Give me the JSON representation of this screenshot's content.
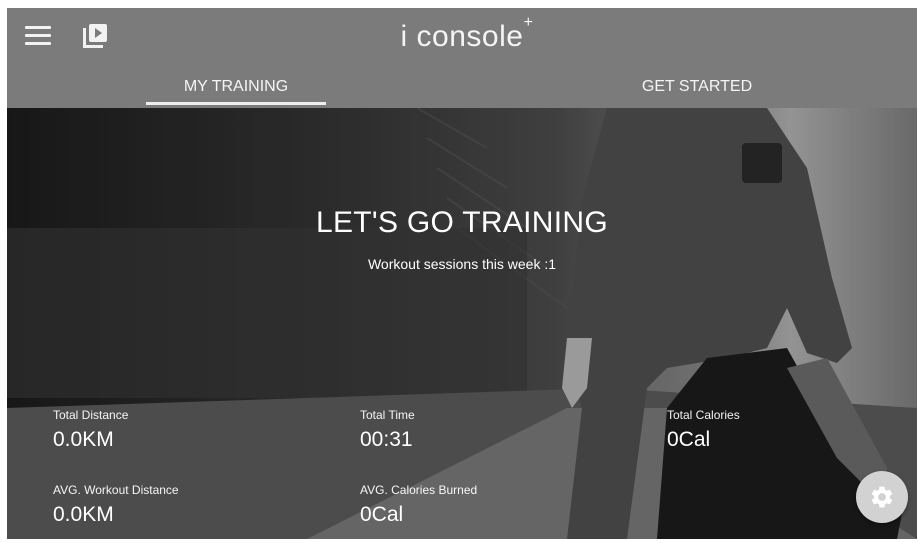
{
  "app": {
    "logo_text": "i console",
    "logo_mark": "+"
  },
  "header": {
    "menu_icon": "hamburger-menu-icon",
    "video_icon": "video-library-icon",
    "tabs": [
      {
        "label": "MY TRAINING",
        "active": true
      },
      {
        "label": "GET STARTED",
        "active": false
      }
    ]
  },
  "hero": {
    "title": "LET'S GO TRAINING",
    "subtitle": "Workout sessions this week :1"
  },
  "stats": {
    "total_distance": {
      "label": "Total Distance",
      "value": "0.0KM"
    },
    "total_time": {
      "label": "Total Time",
      "value": "00:31"
    },
    "total_calories": {
      "label": "Total Calories",
      "value": "0Cal"
    },
    "avg_workout_distance": {
      "label": "AVG. Workout Distance",
      "value": "0.0KM"
    },
    "avg_calories_burned": {
      "label": "AVG. Calories Burned",
      "value": "0Cal"
    }
  },
  "settings": {
    "icon": "gear-icon"
  },
  "colors": {
    "appbar": "#7b7b7b",
    "text": "#ffffff",
    "fab": "#d2d2d2"
  }
}
